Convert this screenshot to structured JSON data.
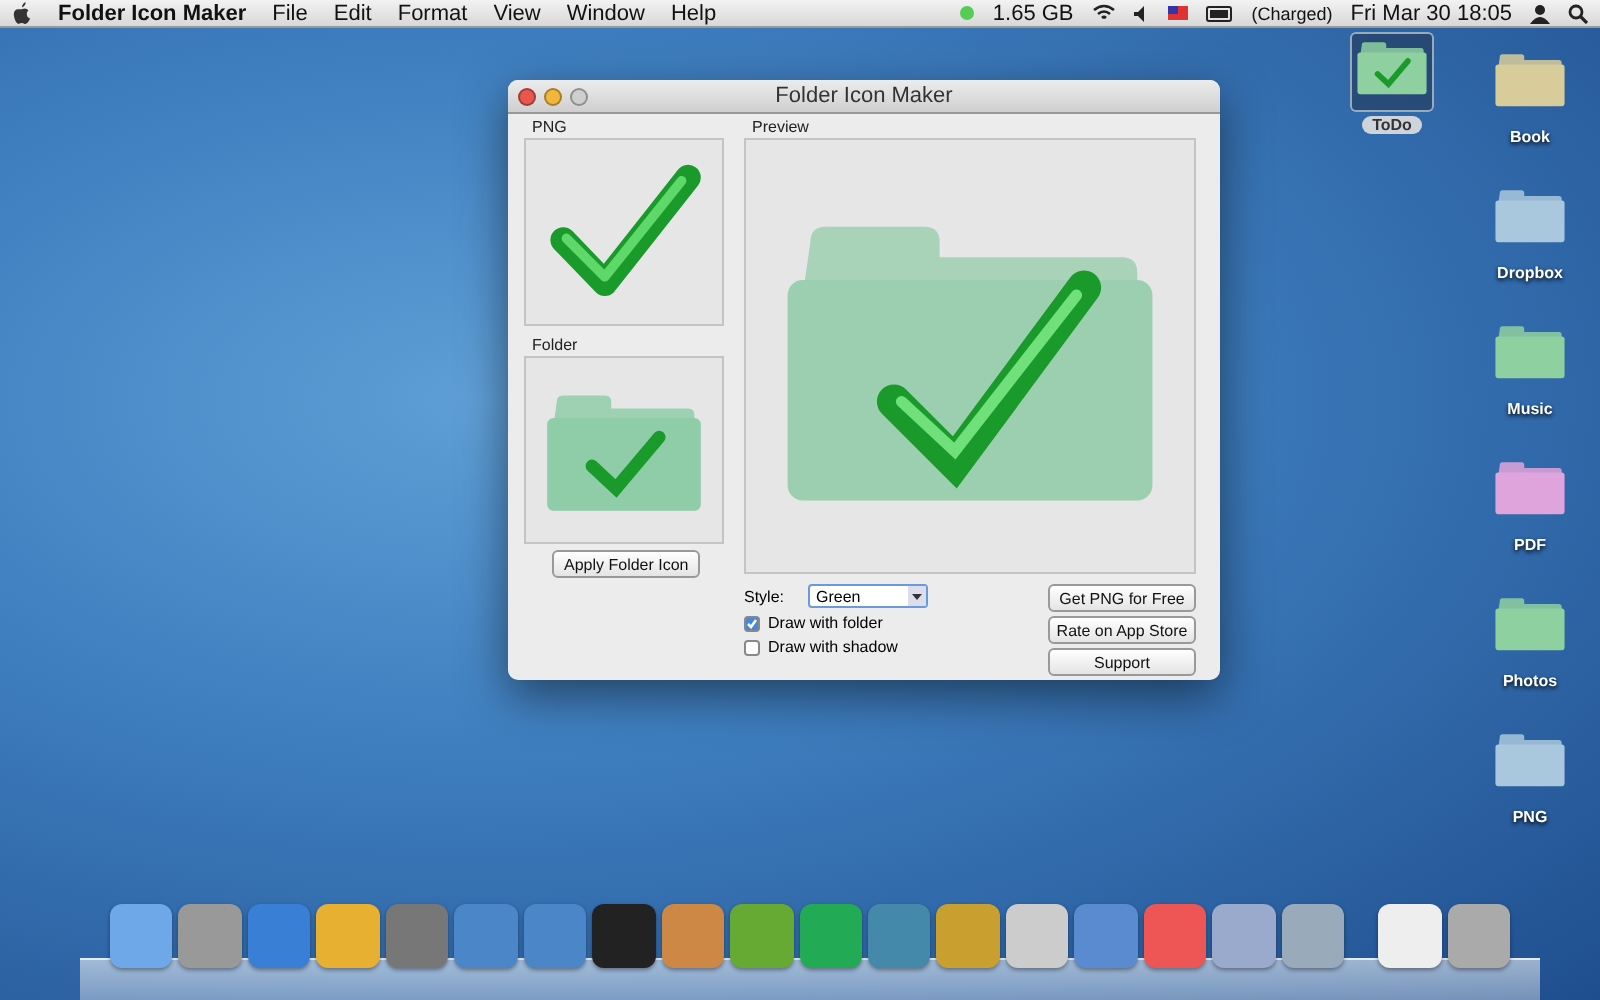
{
  "menu_bar": {
    "app_name": "Folder Icon Maker",
    "menus": [
      "File",
      "Edit",
      "Format",
      "View",
      "Window",
      "Help"
    ],
    "memory": "1.65 GB",
    "battery": "(Charged)",
    "clock": "Fri Mar 30  18:05"
  },
  "window": {
    "title": "Folder Icon Maker",
    "png_label": "PNG",
    "folder_label": "Folder",
    "preview_label": "Preview",
    "apply_button": "Apply Folder Icon",
    "style": {
      "label": "Style:",
      "value": "Green"
    },
    "options": [
      {
        "label": "Draw with folder",
        "checked": true
      },
      {
        "label": "Draw with shadow",
        "checked": false
      }
    ],
    "buttons": [
      "Get PNG for Free",
      "Rate on App Store",
      "Support"
    ]
  },
  "desktop_icons": [
    {
      "label": "ToDo",
      "selected": true,
      "color": "#8fd0a0"
    },
    {
      "label": "Book",
      "selected": false,
      "color": "#d8cc9a"
    },
    {
      "label": "Dropbox",
      "selected": false,
      "color": "#a9c8de"
    },
    {
      "label": "Music",
      "selected": false,
      "color": "#8fd0a0"
    },
    {
      "label": "PDF",
      "selected": false,
      "color": "#e0a4dc"
    },
    {
      "label": "Photos",
      "selected": false,
      "color": "#8fd0a0"
    },
    {
      "label": "PNG",
      "selected": false,
      "color": "#a9c8de"
    }
  ]
}
